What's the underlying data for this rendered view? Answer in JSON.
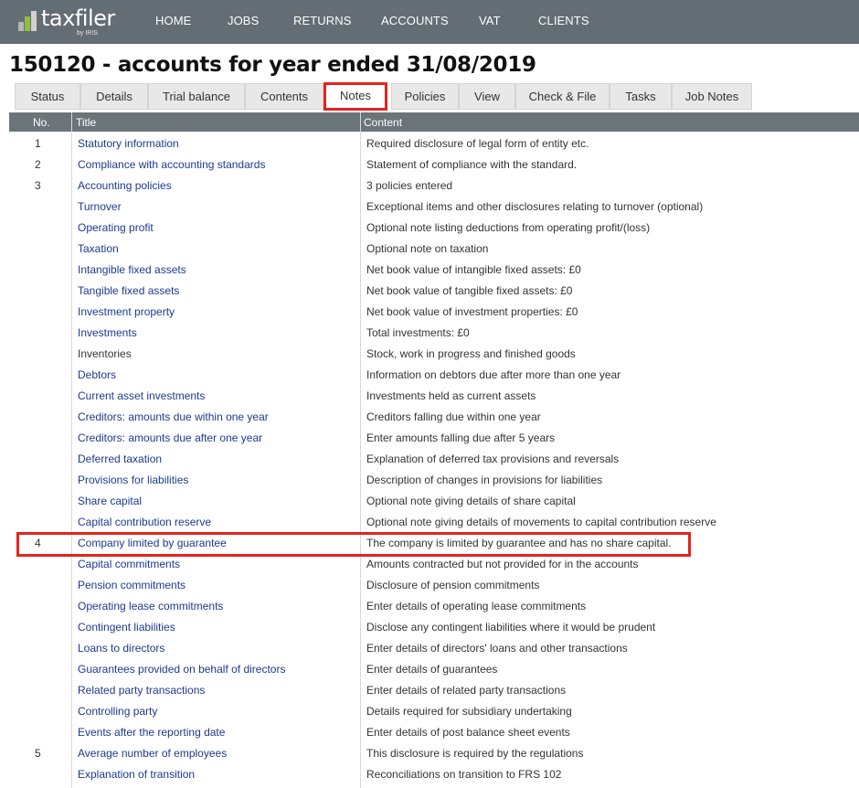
{
  "brand": {
    "name": "taxfiler",
    "sub": "by IRIS"
  },
  "nav": [
    "HOME",
    "JOBS",
    "RETURNS",
    "ACCOUNTS",
    "VAT",
    "CLIENTS"
  ],
  "page_title": "150120 - accounts for year ended 31/08/2019",
  "tabs": [
    "Status",
    "Details",
    "Trial balance",
    "Contents",
    "Notes",
    "Policies",
    "View",
    "Check & File",
    "Tasks",
    "Job Notes"
  ],
  "active_tab": "Notes",
  "table": {
    "headers": {
      "no": "No.",
      "title": "Title",
      "content": "Content"
    },
    "rows": [
      {
        "no": "1",
        "title": "Statutory information",
        "content": "Required disclosure of legal form of entity etc."
      },
      {
        "no": "2",
        "title": "Compliance with accounting standards",
        "content": "Statement of compliance with the standard."
      },
      {
        "no": "3",
        "title": "Accounting policies",
        "content": "3 policies entered"
      },
      {
        "no": "",
        "title": "Turnover",
        "content": "Exceptional items and other disclosures relating to turnover (optional)"
      },
      {
        "no": "",
        "title": "Operating profit",
        "content": "Optional note listing deductions from operating profit/(loss)"
      },
      {
        "no": "",
        "title": "Taxation",
        "content": "Optional note on taxation"
      },
      {
        "no": "",
        "title": "Intangible fixed assets",
        "content": "Net book value of intangible fixed assets: £0"
      },
      {
        "no": "",
        "title": "Tangible fixed assets",
        "content": "Net book value of tangible fixed assets: £0"
      },
      {
        "no": "",
        "title": "Investment property",
        "content": "Net book value of investment properties: £0"
      },
      {
        "no": "",
        "title": "Investments",
        "content": "Total investments: £0"
      },
      {
        "no": "",
        "title": "Inventories",
        "content": "Stock, work in progress and finished goods"
      },
      {
        "no": "",
        "title": "Debtors",
        "content": "Information on debtors due after more than one year"
      },
      {
        "no": "",
        "title": "Current asset investments",
        "content": "Investments held as current assets"
      },
      {
        "no": "",
        "title": "Creditors: amounts due within one year",
        "content": "Creditors falling due within one year"
      },
      {
        "no": "",
        "title": "Creditors: amounts due after one year",
        "content": "Enter amounts falling due after 5 years"
      },
      {
        "no": "",
        "title": "Deferred taxation",
        "content": "Explanation of deferred tax provisions and reversals"
      },
      {
        "no": "",
        "title": "Provisions for liabilities",
        "content": "Description of changes in provisions for liabilities"
      },
      {
        "no": "",
        "title": "Share capital",
        "content": "Optional note giving details of share capital"
      },
      {
        "no": "",
        "title": "Capital contribution reserve",
        "content": "Optional note giving details of movements to capital contribution reserve"
      },
      {
        "no": "4",
        "title": "Company limited by guarantee",
        "content": "The company is limited by guarantee and has no share capital."
      },
      {
        "no": "",
        "title": "Capital commitments",
        "content": "Amounts contracted but not provided for in the accounts"
      },
      {
        "no": "",
        "title": "Pension commitments",
        "content": "Disclosure of pension commitments"
      },
      {
        "no": "",
        "title": "Operating lease commitments",
        "content": "Enter details of operating lease commitments"
      },
      {
        "no": "",
        "title": "Contingent liabilities",
        "content": "Disclose any contingent liabilities where it would be prudent"
      },
      {
        "no": "",
        "title": "Loans to directors",
        "content": "Enter details of directors' loans and other transactions"
      },
      {
        "no": "",
        "title": "Guarantees provided on behalf of directors",
        "content": "Enter details of guarantees"
      },
      {
        "no": "",
        "title": "Related party transactions",
        "content": "Enter details of related party transactions"
      },
      {
        "no": "",
        "title": "Controlling party",
        "content": "Details required for subsidiary undertaking"
      },
      {
        "no": "",
        "title": "Events after the reporting date",
        "content": "Enter details of post balance sheet events"
      },
      {
        "no": "5",
        "title": "Average number of employees",
        "content": "This disclosure is required by the regulations"
      },
      {
        "no": "",
        "title": "Explanation of transition",
        "content": "Reconciliations on transition to FRS 102"
      }
    ]
  },
  "plain_titles": [
    "Inventories"
  ],
  "colors": {
    "accent": "#e3251c",
    "topbar": "#646d73",
    "link": "#1a3a8f"
  }
}
